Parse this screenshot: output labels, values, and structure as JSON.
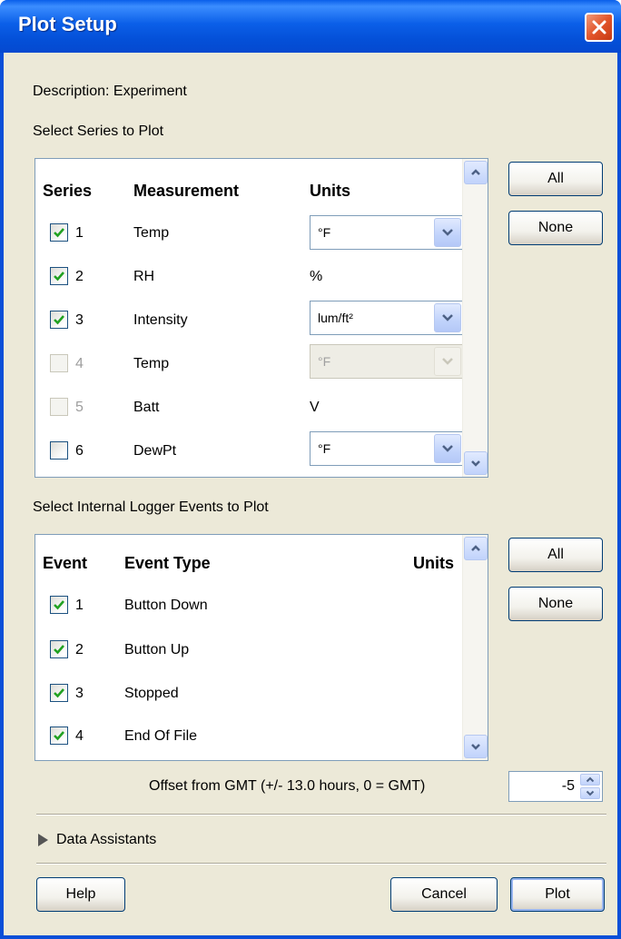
{
  "window": {
    "title": "Plot Setup"
  },
  "description": {
    "label": "Description: Experiment"
  },
  "series_section": {
    "heading": "Select Series to Plot",
    "headers": {
      "series": "Series",
      "measurement": "Measurement",
      "units": "Units"
    },
    "rows": [
      {
        "num": "1",
        "measurement": "Temp",
        "units": "°F",
        "checked": true,
        "enabled": true,
        "dropdown": true
      },
      {
        "num": "2",
        "measurement": "RH",
        "units": "%",
        "checked": true,
        "enabled": true,
        "dropdown": false
      },
      {
        "num": "3",
        "measurement": "Intensity",
        "units": "lum/ft²",
        "checked": true,
        "enabled": true,
        "dropdown": true
      },
      {
        "num": "4",
        "measurement": "Temp",
        "units": "°F",
        "checked": false,
        "enabled": false,
        "dropdown": true
      },
      {
        "num": "5",
        "measurement": "Batt",
        "units": "V",
        "checked": false,
        "enabled": false,
        "dropdown": false
      },
      {
        "num": "6",
        "measurement": "DewPt",
        "units": "°F",
        "checked": false,
        "enabled": true,
        "dropdown": true
      }
    ],
    "all_label": "All",
    "none_label": "None"
  },
  "events_section": {
    "heading": "Select Internal Logger Events to Plot",
    "headers": {
      "event": "Event",
      "event_type": "Event Type",
      "units": "Units"
    },
    "rows": [
      {
        "num": "1",
        "type": "Button Down",
        "checked": true
      },
      {
        "num": "2",
        "type": "Button Up",
        "checked": true
      },
      {
        "num": "3",
        "type": "Stopped",
        "checked": true
      },
      {
        "num": "4",
        "type": "End Of File",
        "checked": true
      }
    ],
    "all_label": "All",
    "none_label": "None"
  },
  "offset": {
    "label": "Offset from GMT (+/- 13.0 hours, 0 = GMT)",
    "value": "-5"
  },
  "data_assistants": {
    "label": "Data Assistants"
  },
  "footer": {
    "help_label": "Help",
    "cancel_label": "Cancel",
    "plot_label": "Plot"
  },
  "colors": {
    "titlebar": "#0A5FEA",
    "window_bg": "#ECE9D8",
    "check_green": "#21A121",
    "close_red": "#E2552B"
  }
}
